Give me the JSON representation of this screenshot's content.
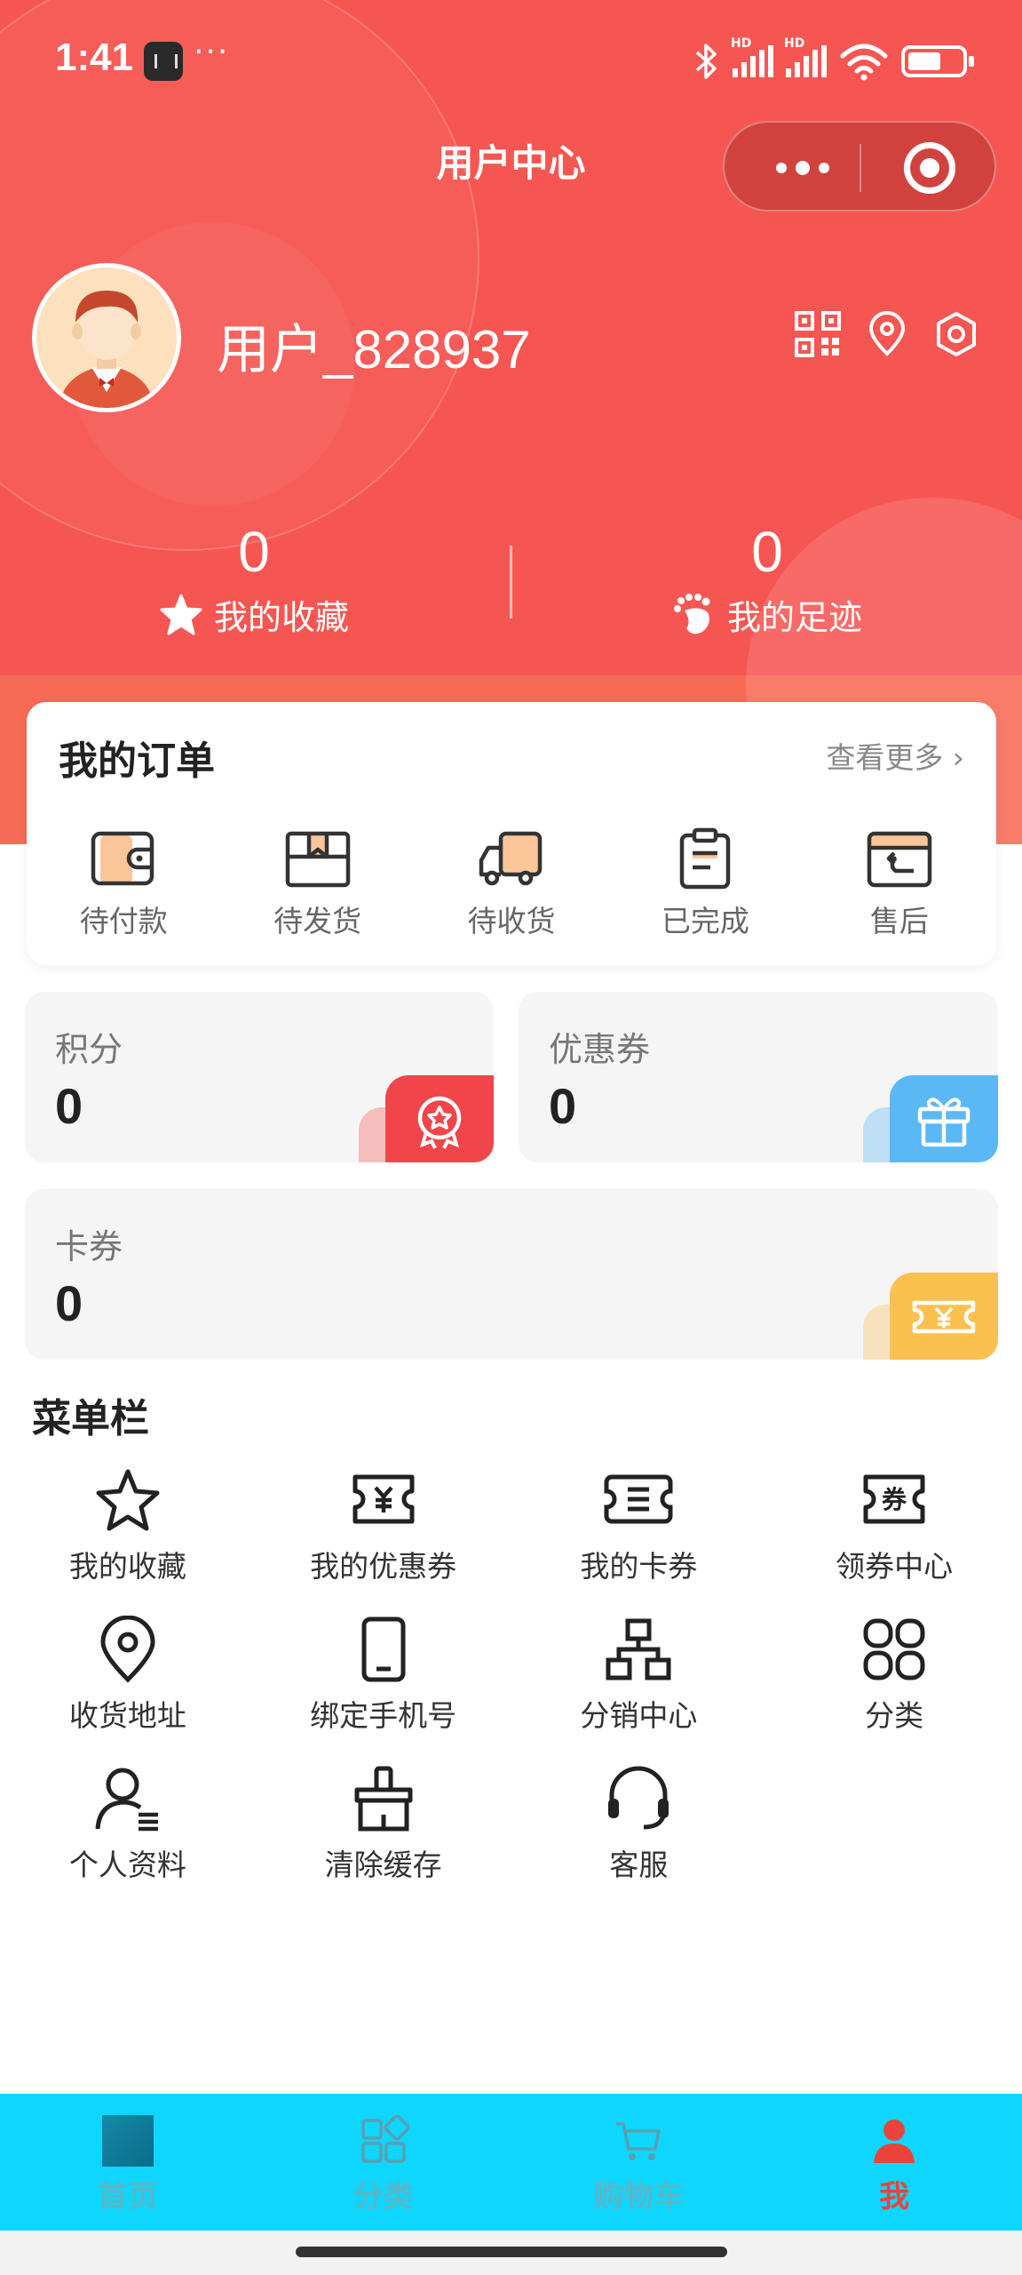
{
  "status_bar": {
    "time": "1:41",
    "dots": "···"
  },
  "nav": {
    "title": "用户中心"
  },
  "profile": {
    "username": "用户_828937"
  },
  "stats": {
    "favorites": {
      "count": "0",
      "label": "我的收藏"
    },
    "footprints": {
      "count": "0",
      "label": "我的足迹"
    }
  },
  "orders": {
    "title": "我的订单",
    "more": "查看更多 ›",
    "items": [
      {
        "label": "待付款",
        "icon": "wallet-icon"
      },
      {
        "label": "待发货",
        "icon": "box-icon"
      },
      {
        "label": "待收货",
        "icon": "truck-icon"
      },
      {
        "label": "已完成",
        "icon": "clipboard-icon"
      },
      {
        "label": "售后",
        "icon": "return-icon"
      }
    ]
  },
  "assets": {
    "points": {
      "label": "积分",
      "value": "0"
    },
    "coupons": {
      "label": "优惠券",
      "value": "0"
    },
    "cards": {
      "label": "卡券",
      "value": "0"
    }
  },
  "menu": {
    "title": "菜单栏",
    "items": [
      {
        "label": "我的收藏",
        "icon": "star-icon"
      },
      {
        "label": "我的优惠券",
        "icon": "coupon-icon"
      },
      {
        "label": "我的卡券",
        "icon": "card-ticket-icon"
      },
      {
        "label": "领券中心",
        "icon": "coupon-center-icon"
      },
      {
        "label": "收货地址",
        "icon": "location-icon"
      },
      {
        "label": "绑定手机号",
        "icon": "phone-icon"
      },
      {
        "label": "分销中心",
        "icon": "hierarchy-icon"
      },
      {
        "label": "分类",
        "icon": "category-icon"
      },
      {
        "label": "个人资料",
        "icon": "profile-icon"
      },
      {
        "label": "清除缓存",
        "icon": "broom-icon"
      },
      {
        "label": "客服",
        "icon": "headset-icon"
      }
    ]
  },
  "tabbar": {
    "items": [
      {
        "label": "首页"
      },
      {
        "label": "分类"
      },
      {
        "label": "购物车"
      },
      {
        "label": "我"
      }
    ]
  },
  "colors": {
    "header_red": "#f65652",
    "accent_red": "#e9433a",
    "tab_bg": "#0ed6ff",
    "coupon_blue": "#5ab8f5",
    "card_yellow": "#fbc14f"
  }
}
